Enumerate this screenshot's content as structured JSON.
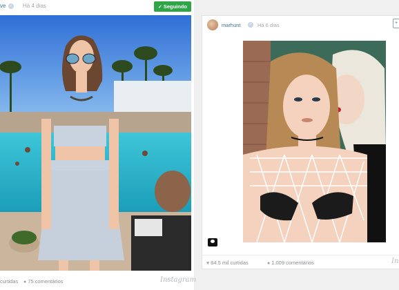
{
  "left_post": {
    "username": "ve",
    "time": "Há 4 dias",
    "follow_label": "Seguindo",
    "likes": "curtidas",
    "comments": "75 comentários",
    "brand": "Instagram"
  },
  "right_post": {
    "username": "marhunt",
    "time": "Há 6 dias",
    "likes": "84.5 mil curtidas",
    "comments": "1.009 comentários",
    "brand": "Ins"
  },
  "icons": {
    "verified": "verified-badge-icon",
    "heart": "heart-icon",
    "comment": "comment-bubble-icon",
    "user_tag": "user-tag-icon",
    "check": "checkmark-icon"
  },
  "colors": {
    "follow_green": "#2fa548",
    "username_blue": "#3f729b",
    "muted_gray": "#a5a7aa"
  }
}
